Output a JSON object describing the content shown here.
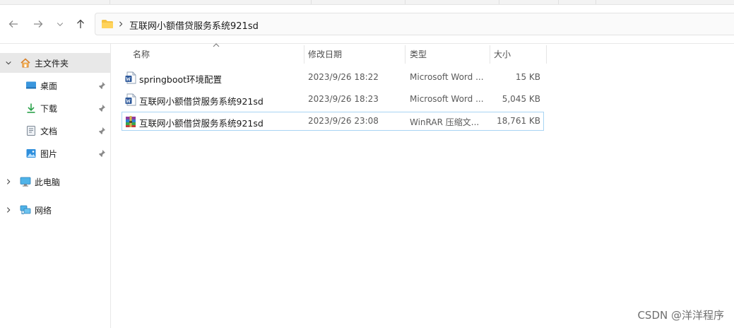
{
  "address": {
    "path": "互联网小额借贷服务系统921sd"
  },
  "nav": {
    "back_icon": "arrow-left-icon",
    "forward_icon": "arrow-right-icon",
    "recent_icon": "chevron-down-icon",
    "up_icon": "arrow-up-icon"
  },
  "sidebar": {
    "items": [
      {
        "label": "主文件夹",
        "icon": "home-icon"
      },
      {
        "label": "桌面",
        "icon": "desktop-icon"
      },
      {
        "label": "下载",
        "icon": "download-icon"
      },
      {
        "label": "文档",
        "icon": "document-icon"
      },
      {
        "label": "图片",
        "icon": "picture-icon"
      },
      {
        "label": "此电脑",
        "icon": "computer-icon"
      },
      {
        "label": "网络",
        "icon": "network-icon"
      }
    ]
  },
  "columns": {
    "name": "名称",
    "date": "修改日期",
    "type": "类型",
    "size": "大小"
  },
  "files": [
    {
      "name": "springboot环境配置",
      "date": "2023/9/26 18:22",
      "type": "Microsoft Word ...",
      "size": "15 KB",
      "icon": "word-document-icon"
    },
    {
      "name": "互联网小额借贷服务系统921sd",
      "date": "2023/9/26 18:23",
      "type": "Microsoft Word ...",
      "size": "5,045 KB",
      "icon": "word-document-icon"
    },
    {
      "name": "互联网小额借贷服务系统921sd",
      "date": "2023/9/26 23:08",
      "type": "WinRAR 压缩文...",
      "size": "18,761 KB",
      "icon": "winrar-archive-icon"
    }
  ],
  "watermark": "CSDN @洋洋程序",
  "colors": {
    "selection_border": "#a8d4f3",
    "folder_yellow": "#f6c343",
    "word_blue": "#2b579a"
  }
}
